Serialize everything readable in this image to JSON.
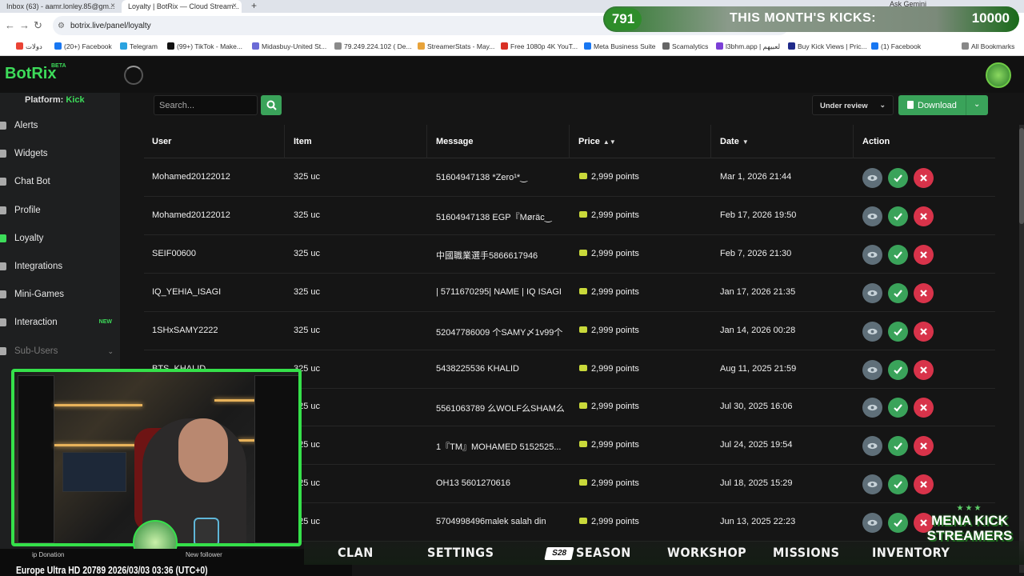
{
  "browser": {
    "tabs": [
      {
        "title": "Inbox (63) - aamr.lonley.85@gm..."
      },
      {
        "title": "Loyalty | BotRix — Cloud Stream..."
      }
    ],
    "new_tab_label": "+",
    "ask_gemini": "Ask Gemini",
    "url": "botrix.live/panel/loyalty",
    "bookmarks": [
      {
        "label": "دولات",
        "color": "#ea4335"
      },
      {
        "label": "(20+) Facebook",
        "color": "#1877f2"
      },
      {
        "label": "Telegram",
        "color": "#2aa3e0"
      },
      {
        "label": "(99+) TikTok - Make...",
        "color": "#111111"
      },
      {
        "label": "Midasbuy-United St...",
        "color": "#6b6bd6"
      },
      {
        "label": "79.249.224.102 ( De...",
        "color": "#8a8a8a"
      },
      {
        "label": "StreamerStats - May...",
        "color": "#e8a33a"
      },
      {
        "label": "Free 1080p 4K YouT...",
        "color": "#d93025"
      },
      {
        "label": "Meta Business Suite",
        "color": "#1877f2"
      },
      {
        "label": "Scamalytics",
        "color": "#666666"
      },
      {
        "label": "l3bhm.app | لعبيهم",
        "color": "#7b3fd6"
      },
      {
        "label": "Buy Kick Views | Pric...",
        "color": "#1f2a8a"
      },
      {
        "label": "(1) Facebook",
        "color": "#1877f2"
      },
      {
        "label": "All Bookmarks",
        "color": "#888888"
      }
    ]
  },
  "overlay": {
    "kicks_count": "791",
    "kicks_title": "THIS MONTH'S KICKS:",
    "kicks_goal": "10000",
    "mena_line1": "MENA KICK",
    "mena_line2": "STREAMERS",
    "mena_stars": "★★★",
    "game_menu": [
      "CLAN",
      "SETTINGS",
      "SEASON",
      "WORKSHOP",
      "MISSIONS",
      "INVENTORY"
    ],
    "season_badge": "S28",
    "strip_top": [
      "ip Donation",
      "New follower"
    ],
    "strip_bottom": "Europe   Ultra HD  20789 2026/03/03 03:36 (UTC+0)"
  },
  "app": {
    "logo": "BotRix",
    "logo_badge": "BETA"
  },
  "sidebar": {
    "platform_label": "Platform:",
    "platform_value": "Kick",
    "items": [
      {
        "label": "Alerts",
        "active": false
      },
      {
        "label": "Widgets",
        "active": false
      },
      {
        "label": "Chat Bot",
        "active": false
      },
      {
        "label": "Profile",
        "active": false
      },
      {
        "label": "Loyalty",
        "active": true
      },
      {
        "label": "Integrations",
        "active": false
      },
      {
        "label": "Mini-Games",
        "active": false
      },
      {
        "label": "Interaction",
        "active": false,
        "badge": "NEW"
      },
      {
        "label": "Sub-Users",
        "active": false
      }
    ]
  },
  "toolbar": {
    "search_placeholder": "Search...",
    "status_filter": "Under review",
    "download_label": "Download"
  },
  "table": {
    "columns": [
      "User",
      "Item",
      "Message",
      "Price",
      "Date",
      "Action"
    ],
    "rows": [
      {
        "user": "Mohamed20122012",
        "item": "325 uc",
        "message": "51604947138 *Zero¹*‿",
        "price": "2,999 points",
        "date": "Mar 1, 2026 21:44"
      },
      {
        "user": "Mohamed20122012",
        "item": "325 uc",
        "message": "51604947138 EGP『Møräc‿",
        "price": "2,999 points",
        "date": "Feb 17, 2026 19:50"
      },
      {
        "user": "SEIF00600",
        "item": "325 uc",
        "message": "中國職業選手5866617946",
        "price": "2,999 points",
        "date": "Feb 7, 2026 21:30"
      },
      {
        "user": "IQ_YEHIA_ISAGI",
        "item": "325 uc",
        "message": "| 5711670295| NAME | IQ ISAGI |",
        "price": "2,999 points",
        "date": "Jan 17, 2026 21:35"
      },
      {
        "user": "1SHxSAMY2222",
        "item": "325 uc",
        "message": "52047786009 个SAMY〆1v99个",
        "price": "2,999 points",
        "date": "Jan 14, 2026 00:28"
      },
      {
        "user": "BTS_KHALID",
        "item": "325 uc",
        "message": "5438225536 KHALID",
        "price": "2,999 points",
        "date": "Aug 11, 2025 21:59"
      },
      {
        "user": "",
        "item": "325 uc",
        "message": "5561063789 么WOLF么SHAM么",
        "price": "2,999 points",
        "date": "Jul 30, 2025 16:06"
      },
      {
        "user": "",
        "item": "325 uc",
        "message": "1『TM』MOHAMED 5152525...",
        "price": "2,999 points",
        "date": "Jul 24, 2025 19:54"
      },
      {
        "user": "",
        "item": "325 uc",
        "message": "OH13 5601270616",
        "price": "2,999 points",
        "date": "Jul 18, 2025 15:29"
      },
      {
        "user": "",
        "item": "325 uc",
        "message": "5704998496malek salah din",
        "price": "2,999 points",
        "date": "Jun 13, 2025 22:23"
      }
    ]
  }
}
